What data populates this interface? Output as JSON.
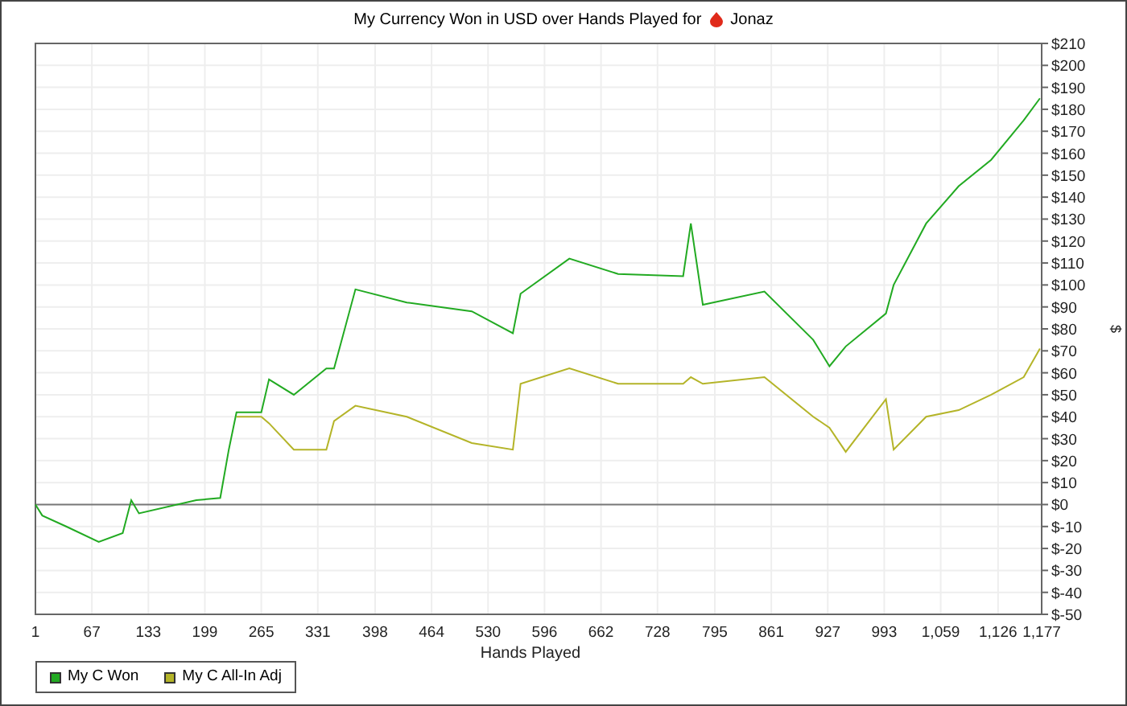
{
  "title": {
    "text": "My Currency Won in USD over Hands Played for",
    "player": "Jonaz"
  },
  "chart_data": {
    "type": "line",
    "xlabel": "Hands Played",
    "ylabel": "$",
    "x": [
      1,
      9,
      37,
      75,
      103,
      113,
      122,
      189,
      217,
      227,
      236,
      265,
      274,
      303,
      341,
      350,
      375,
      435,
      511,
      559,
      568,
      625,
      682,
      758,
      767,
      781,
      853,
      910,
      929,
      948,
      995,
      1004,
      1042,
      1080,
      1118,
      1156,
      1175
    ],
    "series": [
      {
        "name": "My C Won",
        "color": "#22aa22",
        "values": [
          0,
          -5,
          -10,
          -17,
          -13,
          2,
          -4,
          2,
          3,
          25,
          42,
          42,
          57,
          50,
          62,
          62,
          98,
          92,
          88,
          78,
          96,
          112,
          105,
          104,
          128,
          91,
          97,
          75,
          63,
          72,
          87,
          100,
          128,
          145,
          157,
          175,
          185
        ]
      },
      {
        "name": "My C All-In Adj",
        "color": "#b4b428",
        "values": [
          null,
          null,
          null,
          null,
          null,
          null,
          null,
          null,
          null,
          null,
          40,
          40,
          37,
          25,
          25,
          38,
          45,
          40,
          28,
          25,
          55,
          62,
          55,
          55,
          58,
          55,
          58,
          40,
          35,
          24,
          48,
          25,
          40,
          43,
          50,
          58,
          71
        ]
      }
    ],
    "grid": true,
    "xlim": [
      1,
      1177
    ],
    "ylim": [
      -50,
      210
    ],
    "xticks": [
      1,
      67,
      133,
      199,
      265,
      331,
      398,
      464,
      530,
      596,
      662,
      728,
      795,
      861,
      927,
      993,
      {
        "value": 1059,
        "label": "1,059"
      },
      {
        "value": 1126,
        "label": "1,126"
      },
      {
        "value": 1177,
        "label": "1,177"
      }
    ],
    "yticks": [
      {
        "value": 210,
        "label": "$210"
      },
      {
        "value": 200,
        "label": "$200"
      },
      {
        "value": 190,
        "label": "$190"
      },
      {
        "value": 180,
        "label": "$180"
      },
      {
        "value": 170,
        "label": "$170"
      },
      {
        "value": 160,
        "label": "$160"
      },
      {
        "value": 150,
        "label": "$150"
      },
      {
        "value": 140,
        "label": "$140"
      },
      {
        "value": 130,
        "label": "$130"
      },
      {
        "value": 120,
        "label": "$120"
      },
      {
        "value": 110,
        "label": "$110"
      },
      {
        "value": 100,
        "label": "$100"
      },
      {
        "value": 90,
        "label": "$90"
      },
      {
        "value": 80,
        "label": "$80"
      },
      {
        "value": 70,
        "label": "$70"
      },
      {
        "value": 60,
        "label": "$60"
      },
      {
        "value": 50,
        "label": "$50"
      },
      {
        "value": 40,
        "label": "$40"
      },
      {
        "value": 30,
        "label": "$30"
      },
      {
        "value": 20,
        "label": "$20"
      },
      {
        "value": 10,
        "label": "$10"
      },
      {
        "value": 0,
        "label": "$0"
      },
      {
        "value": -10,
        "label": "$-10"
      },
      {
        "value": -20,
        "label": "$-20"
      },
      {
        "value": -30,
        "label": "$-30"
      },
      {
        "value": -40,
        "label": "$-40"
      },
      {
        "value": -50,
        "label": "$-50"
      }
    ]
  }
}
